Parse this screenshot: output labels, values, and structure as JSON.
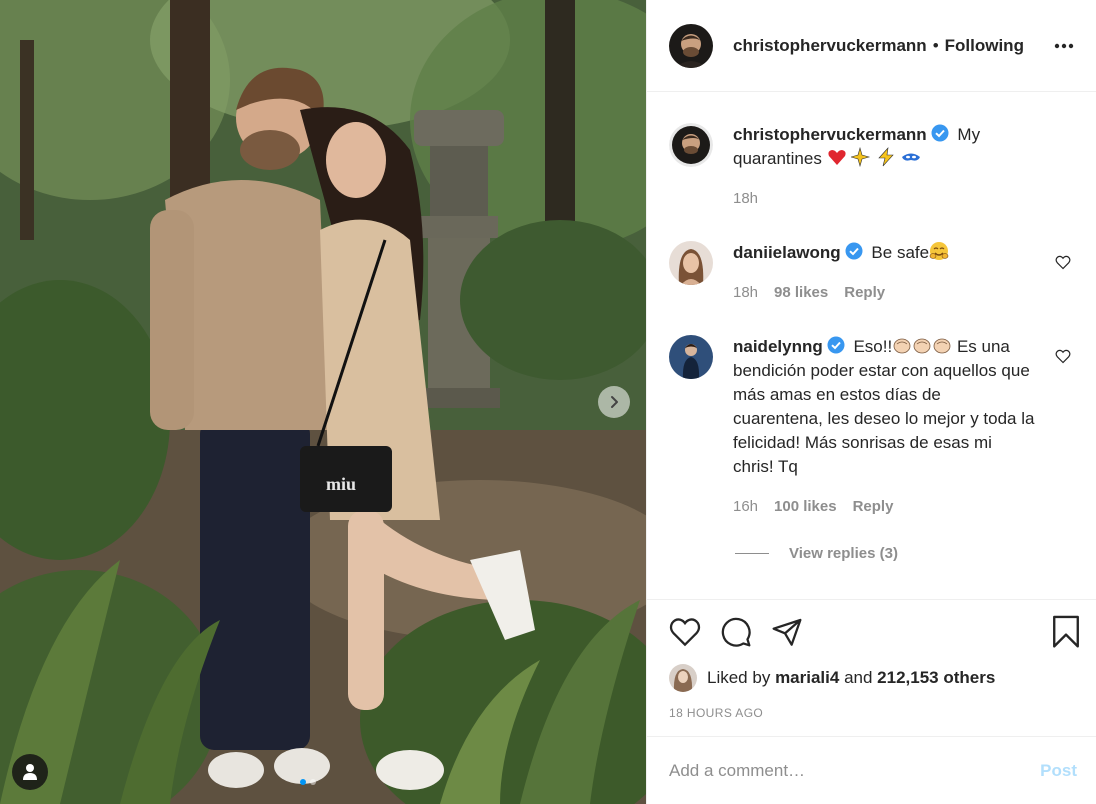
{
  "post": {
    "image_alt": "",
    "author": "christophervuckermann",
    "author_display": "christophervuckermann",
    "following_label": "Following",
    "separator": "•"
  },
  "caption": {
    "username": "christophervuckermann",
    "text": "My quarantines",
    "emojis": [
      "red-heart",
      "sparkles",
      "lightning",
      "superhero-mask"
    ],
    "time": "18h"
  },
  "comments": [
    {
      "username": "daniielawong",
      "verified": true,
      "text": "Be safe",
      "emoji": "hugging-face",
      "time": "18h",
      "likes": "98 likes",
      "reply_label": "Reply"
    },
    {
      "username": "naidelynng",
      "verified": true,
      "text_prefix": "Eso!!",
      "emoji": "clapping-hands",
      "text": "Es una bendición poder estar con aquellos que más amas en estos días de cuarentena, les deseo lo mejor y toda la felicidad! Más sonrisas de esas mi chris! Tq",
      "time": "16h",
      "likes": "100 likes",
      "reply_label": "Reply",
      "view_replies": "View replies (3)"
    }
  ],
  "likes": {
    "prefix": "Liked by",
    "user": "mariali4",
    "middle": "and",
    "count": "212,153 others"
  },
  "timestamp": "18 HOURS AGO",
  "composer": {
    "placeholder": "Add a comment…",
    "post_label": "Post"
  },
  "carousel": {
    "total": 2,
    "current": 1
  },
  "colors": {
    "accent": "#0095f6",
    "verified": "#3897f0",
    "heart": "#ed4956",
    "post_disabled": "#b2dffc"
  },
  "icons": [
    "like-icon",
    "comment-icon",
    "share-icon",
    "save-icon",
    "more-icon",
    "user-tag-icon",
    "chevron-right-icon"
  ]
}
